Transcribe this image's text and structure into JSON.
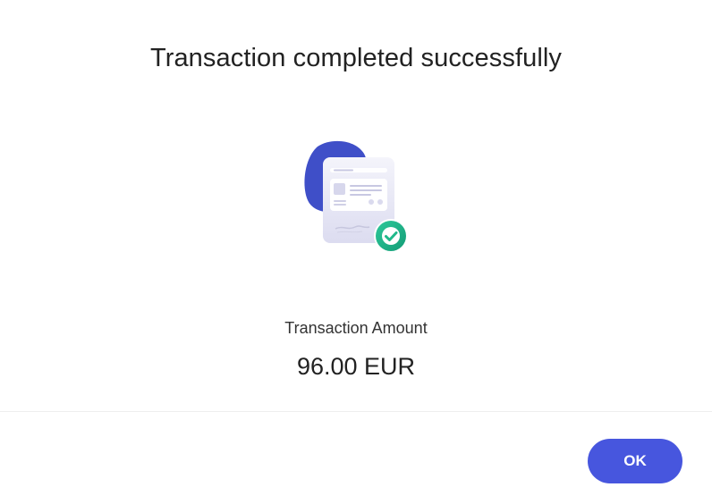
{
  "dialog": {
    "title": "Transaction completed successfully",
    "amount_label": "Transaction Amount",
    "amount_value": "96.00 EUR",
    "ok_label": "OK"
  },
  "illustration": {
    "icon": "receipt-success-icon",
    "badge_icon": "check-circle-icon"
  },
  "colors": {
    "accent": "#4756de",
    "success": "#1fb98a",
    "blob": "#3f4fc8"
  }
}
